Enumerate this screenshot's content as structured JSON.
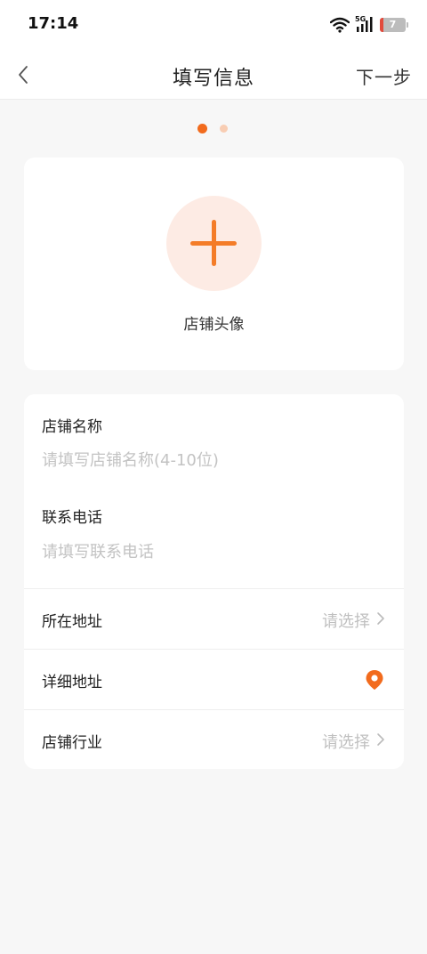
{
  "status_bar": {
    "time": "17:14",
    "network": "5G",
    "battery": "7",
    "icons": [
      "wifi-icon",
      "signal-icon",
      "battery-icon"
    ]
  },
  "nav": {
    "back_icon": "chevron-left-icon",
    "title": "填写信息",
    "next_label": "下一步"
  },
  "pager": {
    "total": 2,
    "active_index": 0,
    "active_color": "#f26b1d",
    "inactive_color": "#f8cdb3"
  },
  "avatar": {
    "icon": "plus-icon",
    "label": "店铺头像"
  },
  "form": {
    "shop_name": {
      "label": "店铺名称",
      "value": "",
      "placeholder": "请填写店铺名称(4-10位)"
    },
    "phone": {
      "label": "联系电话",
      "value": "",
      "placeholder": "请填写联系电话"
    },
    "address": {
      "label": "所在地址",
      "value": "请选择"
    },
    "detail_address": {
      "label": "详细地址",
      "icon": "location-pin-icon"
    },
    "industry": {
      "label": "店铺行业",
      "value": "请选择"
    }
  },
  "colors": {
    "accent": "#f47c28",
    "background": "#f7f7f7",
    "placeholder": "#c3c3c3"
  }
}
